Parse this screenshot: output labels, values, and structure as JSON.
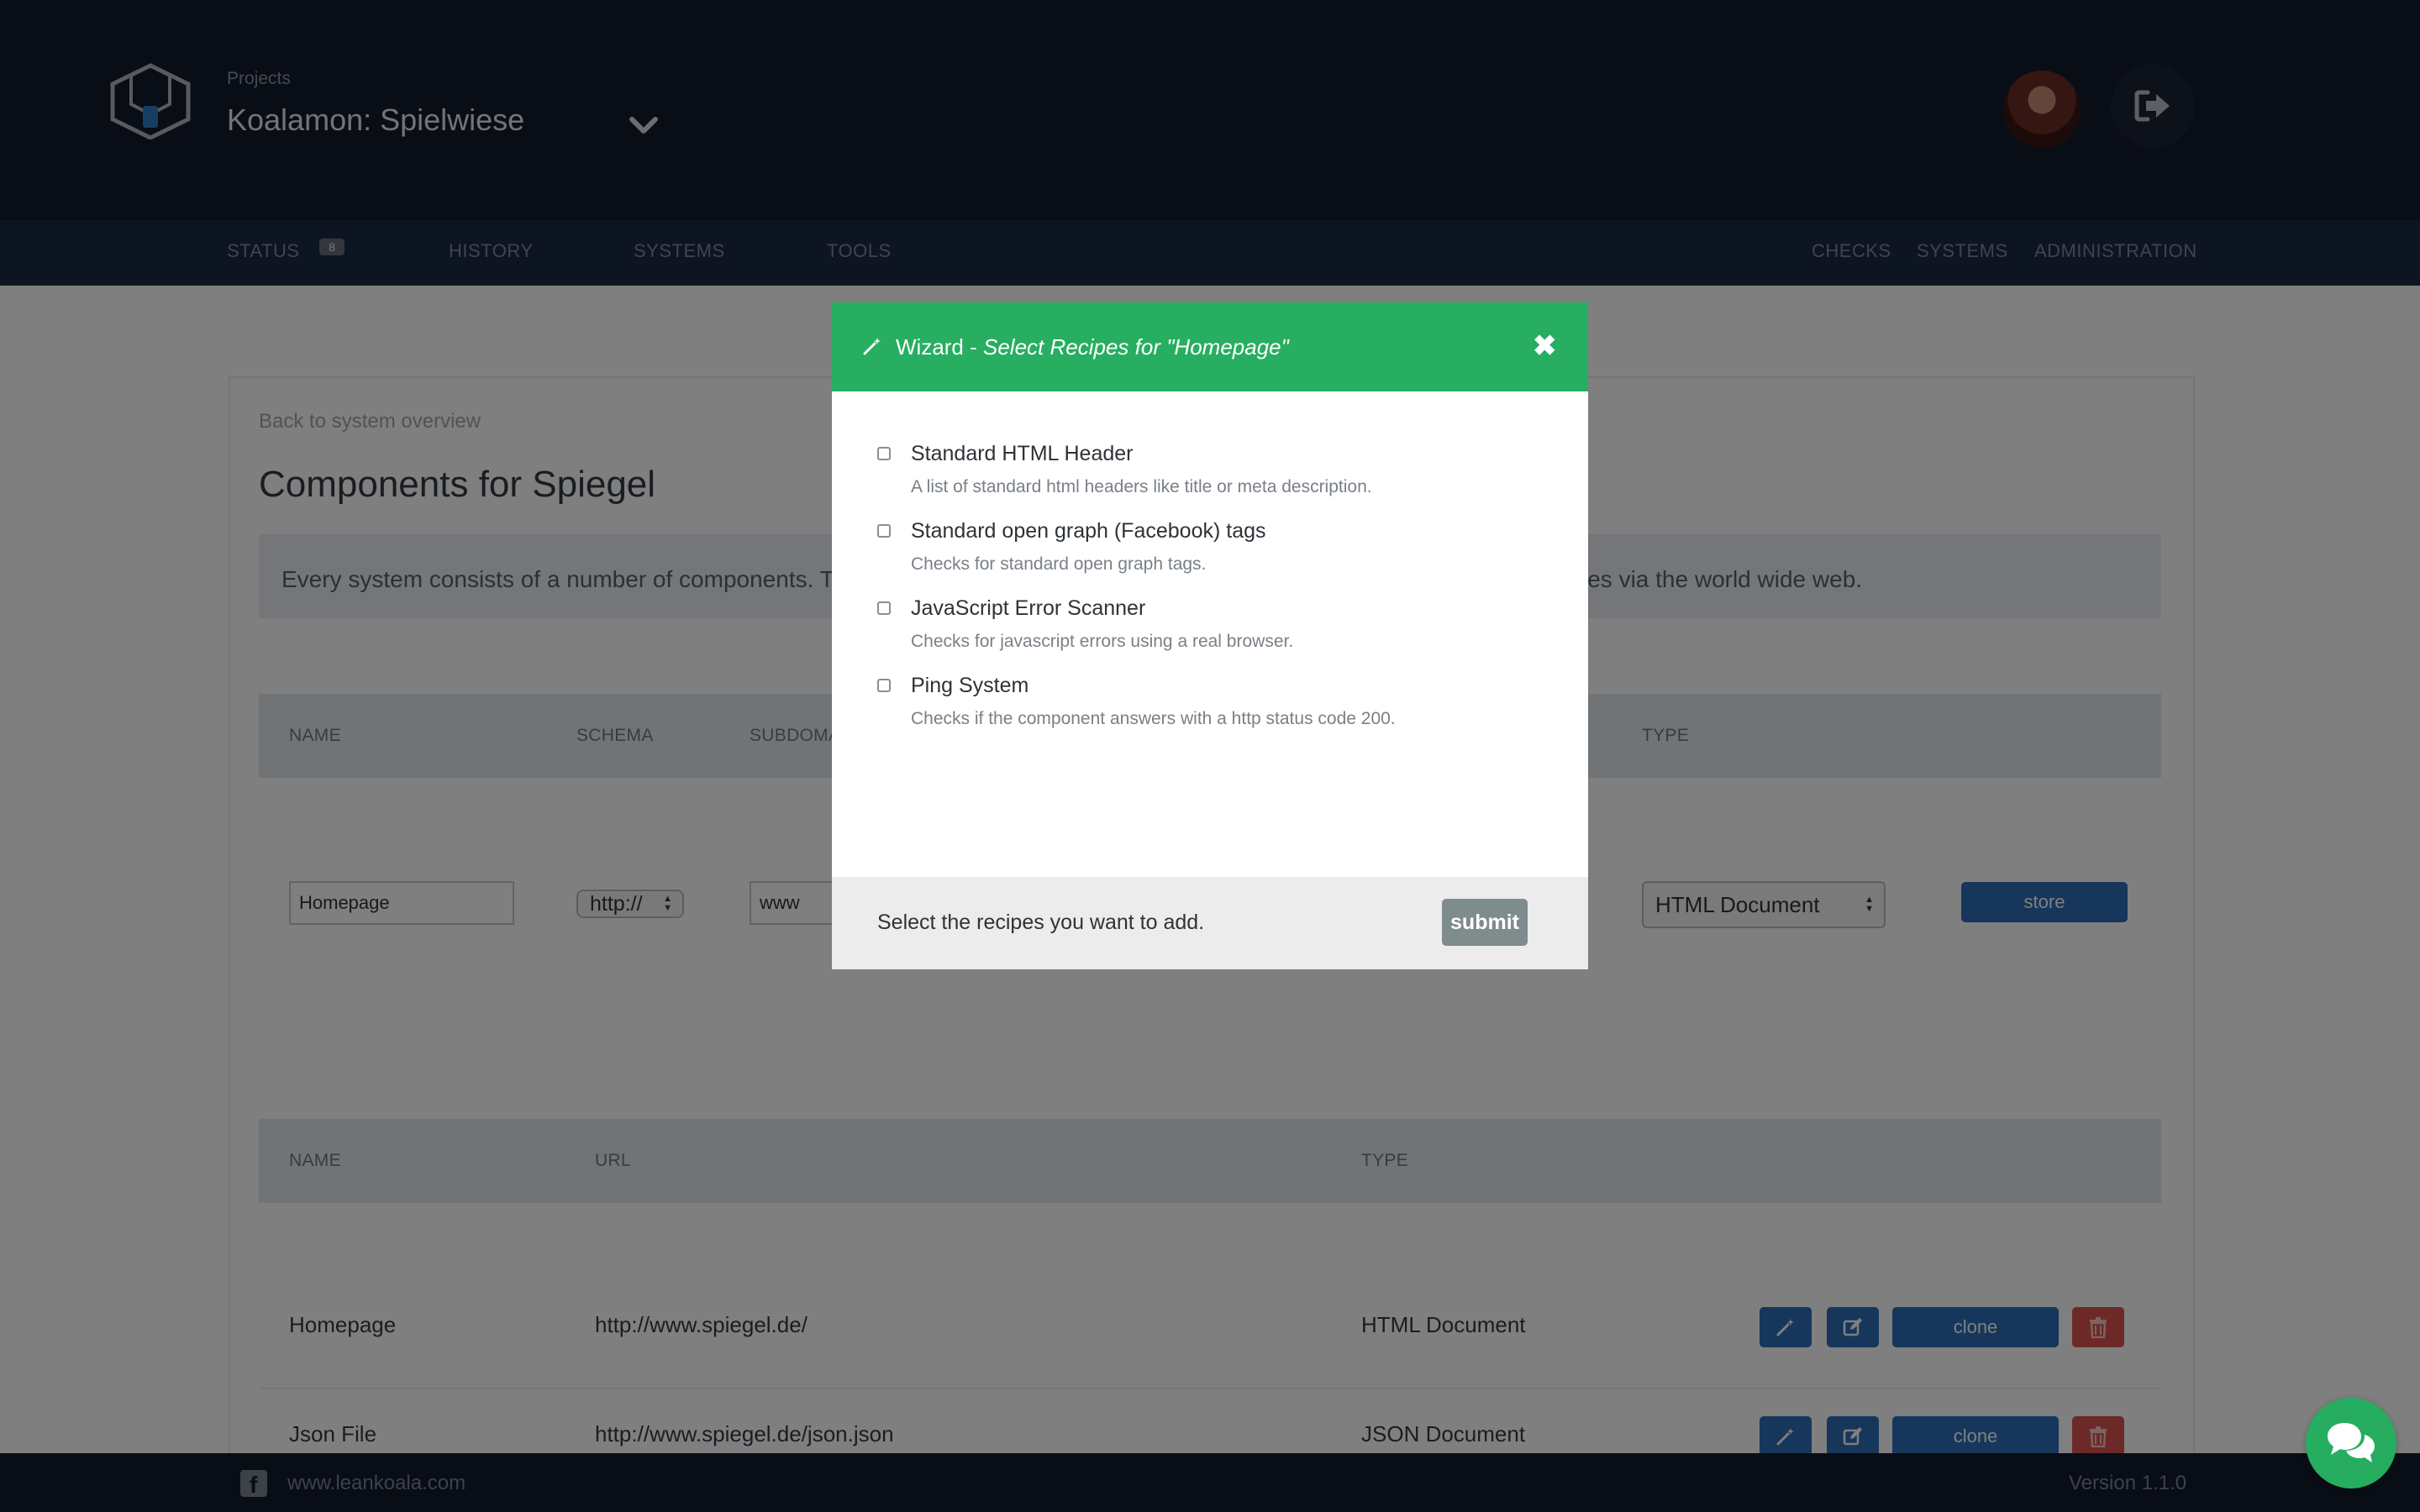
{
  "header": {
    "projects_label": "Projects",
    "project_name": "Koalamon: Spielwiese"
  },
  "nav": {
    "left": [
      {
        "label": "STATUS",
        "badge": "8"
      },
      {
        "label": "HISTORY"
      },
      {
        "label": "SYSTEMS"
      },
      {
        "label": "TOOLS"
      }
    ],
    "right": [
      {
        "label": "CHECKS"
      },
      {
        "label": "SYSTEMS"
      },
      {
        "label": "ADMINISTRATION"
      }
    ]
  },
  "page": {
    "back_link": "Back to system overview",
    "title": "Components for Spiegel",
    "info_part1": "Every system consists of a number of components. The",
    "info_part2": "les via the world wide web."
  },
  "form_table": {
    "headers": {
      "name": "NAME",
      "schema": "SCHEMA",
      "subdomain": "SUBDOMA",
      "type": "TYPE"
    },
    "name_value": "Homepage",
    "schema_value": "http://",
    "subdomain_value": "www",
    "type_value": "HTML Document",
    "store_label": "store"
  },
  "list_table": {
    "headers": {
      "name": "NAME",
      "url": "URL",
      "type": "TYPE"
    },
    "rows": [
      {
        "name": "Homepage",
        "url": "http://www.spiegel.de/",
        "type": "HTML Document",
        "clone": "clone"
      },
      {
        "name": "Json File",
        "url": "http://www.spiegel.de/json.json",
        "type": "JSON Document",
        "clone": "clone"
      }
    ]
  },
  "footer": {
    "link": "www.leankoala.com",
    "version": "Version 1.1.0",
    "fb_glyph": "f"
  },
  "modal": {
    "title_prefix": "Wizard - ",
    "title_sub": "Select Recipes for \"Homepage\"",
    "close_glyph": "✖",
    "recipes": [
      {
        "title": "Standard HTML Header",
        "desc": "A list of standard html headers like title or meta description.",
        "checked": false
      },
      {
        "title": "Standard open graph (Facebook) tags",
        "desc": "Checks for standard open graph tags.",
        "checked": false
      },
      {
        "title": "JavaScript Error Scanner",
        "desc": "Checks for javascript errors using a real browser.",
        "checked": false
      },
      {
        "title": "Ping System",
        "desc": "Checks if the component answers with a http status code 200.",
        "checked": false
      }
    ],
    "hint": "Select the recipes you want to add.",
    "submit_label": "submit"
  },
  "colors": {
    "header_bg": "#131a2c",
    "nav_bg": "#1b2a44",
    "modal_header": "#27ae60",
    "button_blue": "#2c6fb6",
    "button_red": "#d9534f",
    "submit_gray": "#7f8c8d"
  },
  "icons": [
    "logo-hexagon-icon",
    "chevron-down-icon",
    "logout-icon",
    "magic-wand-icon",
    "edit-icon",
    "trash-icon",
    "facebook-icon",
    "chat-icon",
    "close-icon"
  ]
}
